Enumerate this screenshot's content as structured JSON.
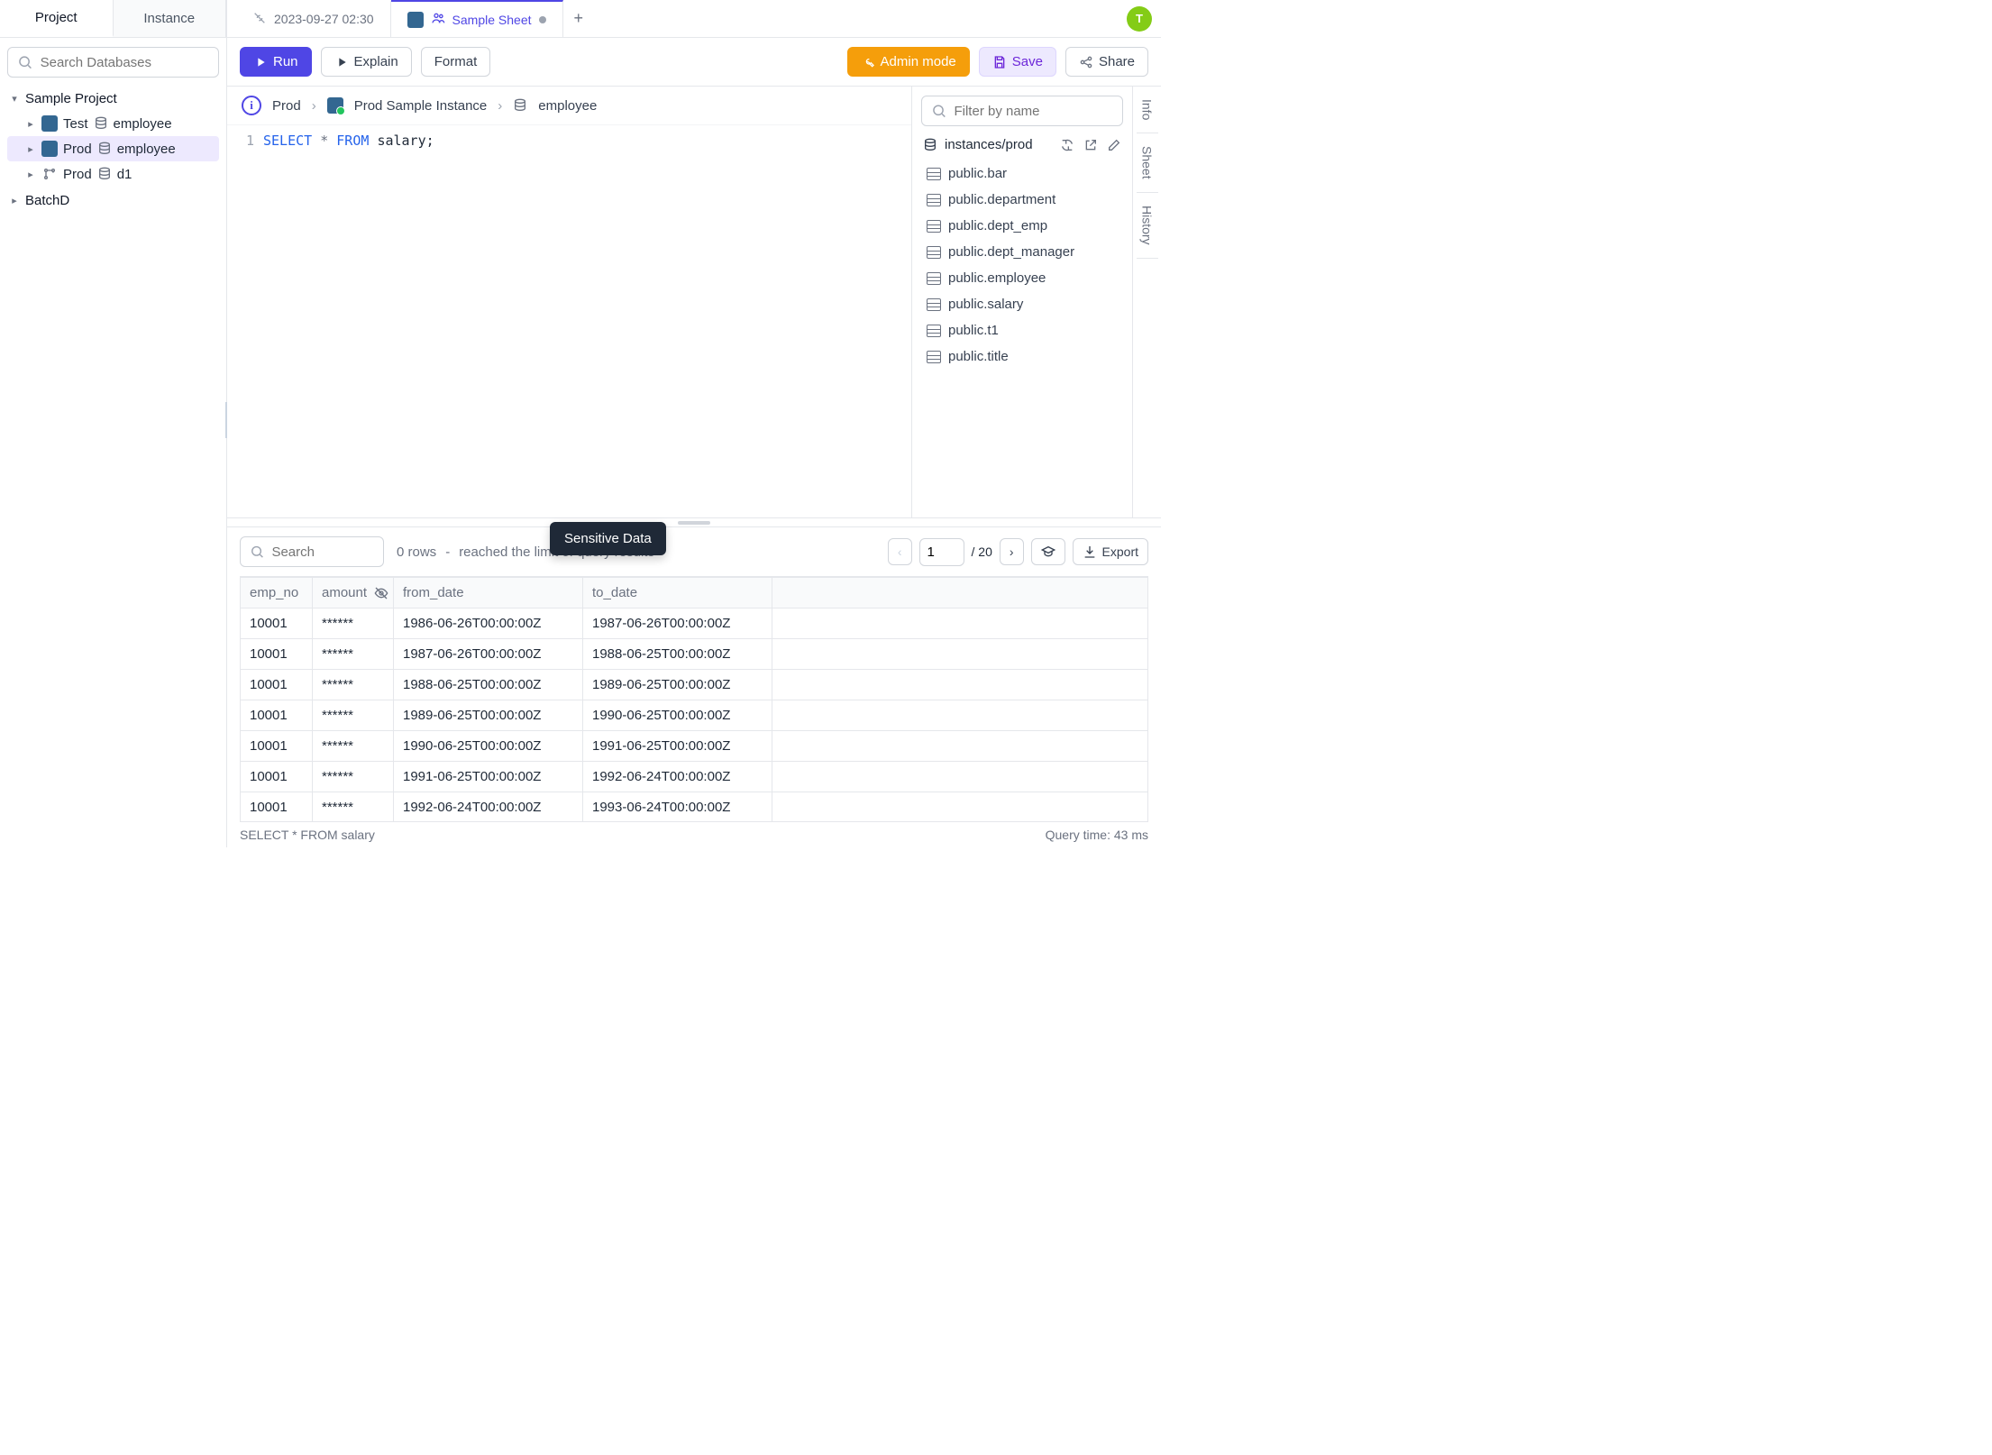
{
  "side_tabs": {
    "project": "Project",
    "instance": "Instance"
  },
  "sidebar": {
    "search_placeholder": "Search Databases",
    "project_name": "Sample Project",
    "items": [
      {
        "env": "Test",
        "db": "employee",
        "kind": "pg"
      },
      {
        "env": "Prod",
        "db": "employee",
        "kind": "pg",
        "selected": true
      },
      {
        "env": "Prod",
        "db": "d1",
        "kind": "branch"
      }
    ],
    "bottom_project": "BatchD"
  },
  "editor_tabs": [
    {
      "label": "2023-09-27 02:30",
      "kind": "disconnected"
    },
    {
      "label": "Sample Sheet",
      "kind": "pg",
      "active": true,
      "dirty": true
    }
  ],
  "avatar_initial": "T",
  "toolbar": {
    "run": "Run",
    "explain": "Explain",
    "format": "Format",
    "admin": "Admin mode",
    "save": "Save",
    "share": "Share"
  },
  "breadcrumb": {
    "env": "Prod",
    "instance": "Prod Sample Instance",
    "table": "employee"
  },
  "code": {
    "line_no": "1",
    "kw_select": "SELECT",
    "star": "*",
    "kw_from": "FROM",
    "ident": "salary;"
  },
  "schema": {
    "filter_placeholder": "Filter by name",
    "instance_path": "instances/prod",
    "tables": [
      "public.bar",
      "public.department",
      "public.dept_emp",
      "public.dept_manager",
      "public.employee",
      "public.salary",
      "public.t1",
      "public.title"
    ]
  },
  "rail": {
    "info": "Info",
    "sheet": "Sheet",
    "history": "History"
  },
  "results": {
    "search_placeholder": "Search",
    "tooltip": "Sensitive Data",
    "row_count_text": "0 rows",
    "row_limit_text": "reached the limit of query results",
    "sep": "-",
    "page": "1",
    "total_pages": "/ 20",
    "export": "Export",
    "columns": {
      "c0": "emp_no",
      "c1": "amount",
      "c2": "from_date",
      "c3": "to_date"
    },
    "rows": [
      {
        "emp_no": "10001",
        "amount": "******",
        "from_date": "1986-06-26T00:00:00Z",
        "to_date": "1987-06-26T00:00:00Z"
      },
      {
        "emp_no": "10001",
        "amount": "******",
        "from_date": "1987-06-26T00:00:00Z",
        "to_date": "1988-06-25T00:00:00Z"
      },
      {
        "emp_no": "10001",
        "amount": "******",
        "from_date": "1988-06-25T00:00:00Z",
        "to_date": "1989-06-25T00:00:00Z"
      },
      {
        "emp_no": "10001",
        "amount": "******",
        "from_date": "1989-06-25T00:00:00Z",
        "to_date": "1990-06-25T00:00:00Z"
      },
      {
        "emp_no": "10001",
        "amount": "******",
        "from_date": "1990-06-25T00:00:00Z",
        "to_date": "1991-06-25T00:00:00Z"
      },
      {
        "emp_no": "10001",
        "amount": "******",
        "from_date": "1991-06-25T00:00:00Z",
        "to_date": "1992-06-24T00:00:00Z"
      },
      {
        "emp_no": "10001",
        "amount": "******",
        "from_date": "1992-06-24T00:00:00Z",
        "to_date": "1993-06-24T00:00:00Z"
      }
    ],
    "status_sql": "SELECT * FROM salary",
    "query_time": "Query time: 43 ms"
  }
}
